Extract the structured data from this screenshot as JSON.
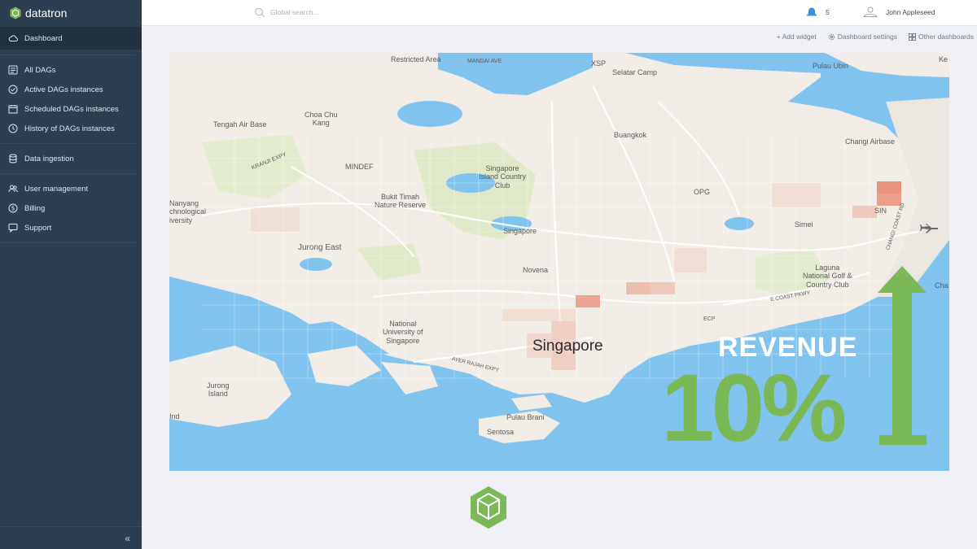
{
  "app": {
    "brand": "datatron"
  },
  "sidebar": {
    "items": [
      {
        "label": "Dashboard",
        "icon": "cloud-icon",
        "active": true
      },
      {
        "label": "All DAGs",
        "icon": "dag-icon"
      },
      {
        "label": "Active DAGs instances",
        "icon": "check-circle-icon"
      },
      {
        "label": "Scheduled DAGs instances",
        "icon": "calendar-icon"
      },
      {
        "label": "History of DAGs instances",
        "icon": "clock-icon"
      },
      {
        "label": "Data ingestion",
        "icon": "database-icon"
      },
      {
        "label": "User management",
        "icon": "users-icon"
      },
      {
        "label": "Billing",
        "icon": "dollar-icon"
      },
      {
        "label": "Support",
        "icon": "support-icon"
      }
    ],
    "collapse_glyph": "«"
  },
  "header": {
    "search_placeholder": "Global search...",
    "notification_count": "5",
    "user_name": "John Appleseed"
  },
  "toolbar": {
    "add_widget": "+ Add widget",
    "dashboard_settings": "Dashboard settings",
    "other_dashboards": "Other dashboards"
  },
  "map": {
    "labels": {
      "restricted_area": "Restricted Area",
      "mandai_ave": "MANDAI AVE",
      "xsp": "XSP",
      "selatar_camp": "Selatar Camp",
      "pulau_ubin": "Pulau Ubin",
      "ke": "Ke",
      "tengah": "Tengah Air Base",
      "choa_chu_kang": "Choa Chu\nKang",
      "buangkok": "Buangkok",
      "changi_airbase": "Changi Airbase",
      "kranji": "KRANJI EXPY",
      "mindef": "MINDEF",
      "sg_island_cc": "Singapore\nIsland Country\nClub",
      "opg": "OPG",
      "sin": "SIN",
      "nanyang": "Nanyang\nchnological\niversity",
      "bukit_timah": "Bukit Timah\nNature Reserve",
      "singapore_small": "Singapore",
      "simei": "Simei",
      "jurong_east": "Jurong East",
      "novena": "Novena",
      "laguna": "Laguna\nNational Golf &\nCountry Club",
      "cha": "Cha",
      "nus": "National\nUniversity of\nSingapore",
      "ecp": "ECP",
      "singapore_big": "Singapore",
      "jurong_island": "Jurong\nIsland",
      "ind": "Ind",
      "pulau_brani": "Pulau Brani",
      "sentosa": "Sentosa",
      "ayer_rajah": "AYER RAJAH EXPY",
      "changi_coast": "CHANGI COAST RD",
      "e_coast": "E COAST PKWY"
    },
    "overlay": {
      "title": "REVENUE",
      "value": "10%"
    },
    "colors": {
      "water": "#80c3ee",
      "land": "#f1ede6",
      "park": "#dfe8c8",
      "heat": "#e8836a",
      "accent": "#7ab955"
    }
  }
}
